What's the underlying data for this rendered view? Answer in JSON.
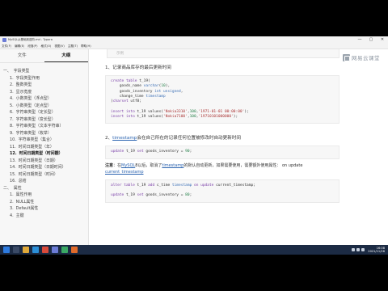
{
  "window": {
    "title": "MySQL从基础到进阶.md - Typora",
    "controls": [
      "—",
      "▢",
      "✕"
    ]
  },
  "menu": [
    "文件(F)",
    "编辑(E)",
    "段落(P)",
    "格式(O)",
    "视图(V)",
    "主题(T)",
    "帮助(H)"
  ],
  "sidebar": {
    "tabs": [
      "文件",
      "大纲"
    ],
    "outline": [
      {
        "num": "一、",
        "label": "字段类型",
        "level": 1
      },
      {
        "num": "1.",
        "label": "字段类型作用",
        "level": 2
      },
      {
        "num": "2.",
        "label": "整数类型",
        "level": 2
      },
      {
        "num": "3.",
        "label": "显示宽度",
        "level": 2
      },
      {
        "num": "4.",
        "label": "小数类型（浮点型）",
        "level": 2
      },
      {
        "num": "5.",
        "label": "小数类型（定点型）",
        "level": 2
      },
      {
        "num": "6.",
        "label": "字符串类型（定长型）",
        "level": 2
      },
      {
        "num": "7.",
        "label": "字符串类型（变长型）",
        "level": 2
      },
      {
        "num": "8.",
        "label": "字符串类型（文本字符串）",
        "level": 2
      },
      {
        "num": "9.",
        "label": "字符串类型（枚举）",
        "level": 2
      },
      {
        "num": "10.",
        "label": "字符串类型（集合）",
        "level": 2
      },
      {
        "num": "11.",
        "label": "时间日期类型（年）",
        "level": 2
      },
      {
        "num": "12.",
        "label": "时间日期类型（时间戳）",
        "level": 2,
        "active": true
      },
      {
        "num": "13.",
        "label": "时间日期类型（日期）",
        "level": 2
      },
      {
        "num": "14.",
        "label": "时间日期类型（日期时间）",
        "level": 2
      },
      {
        "num": "15.",
        "label": "时间日期类型（时间）",
        "level": 2
      },
      {
        "num": "16.",
        "label": "总结",
        "level": 2
      },
      {
        "num": "二、",
        "label": "属性",
        "level": 1
      },
      {
        "num": "1.",
        "label": "属性作用",
        "level": 2
      },
      {
        "num": "2.",
        "label": "NULL属性",
        "level": 2
      },
      {
        "num": "3.",
        "label": "Default属性",
        "level": 2
      },
      {
        "num": "4.",
        "label": "主键",
        "level": 2
      }
    ]
  },
  "editor": {
    "lang_tag": "示例",
    "logo_text": "网易云课堂",
    "heading1": "1、记录商品库存的最后更新时间",
    "code1": {
      "line1_kw": "create table",
      "line1_rest": " t_19(",
      "line2_name": "    goods_name ",
      "line2_type": "varchar",
      "line2_num": "10",
      "line2_end": "),",
      "line3_name": "    goods_inventory ",
      "line3_type": "int unsigned",
      "line3_end": ",",
      "line4_name": "    change_time ",
      "line4_type": "timestamp",
      "line5_start": ")",
      "line5_kw": "charset",
      "line5_end": " utf8;",
      "line7_kw": "insert into",
      "line7_mid": " t_19 values(",
      "line7_s1": "'Nokia3310'",
      "line7_c1": ",",
      "line7_n1": "100",
      "line7_c2": ",",
      "line7_s2": "'1971-01-01 00:00:00'",
      "line7_end": ");",
      "line8_kw": "insert into",
      "line8_mid": " t_19 values(",
      "line8_s1": "'Nokia7100'",
      "line8_c1": ",",
      "line8_n1": "100",
      "line8_c2": ",",
      "line8_s2": "'19710101000000'",
      "line8_end": ");"
    },
    "heading2_prefix": "2、",
    "heading2_link": "timestamp",
    "heading2_rest": "会在自己所在的记录任何位置被修改时自动更新时间",
    "code2": {
      "kw": "update",
      "rest": " t_19 ",
      "kw2": "set",
      "rest2": " goods_inventory = ",
      "num": "90",
      "end": ";"
    },
    "note": {
      "label": "注意",
      "text1": "：在",
      "link1": "MySQL",
      "text2": "8以后，取消了",
      "link2": "timestamp",
      "text3": "的默认自动更新，如果需要使用，需要额外使用属性： on update ",
      "link3": "current_timestamp"
    },
    "code3": {
      "kw": "alter table",
      "rest": " t_19 ",
      "kw2": "add",
      "rest2": " c_time ",
      "ty": "timestamp",
      "kw3": " on update",
      "rest3": " current_timestamp;",
      "kw4": "update",
      "rest4": " t_19 ",
      "kw5": "set",
      "rest5": " goods_inventory = ",
      "num": "80",
      "end": ";"
    }
  },
  "taskbar": {
    "time": "16:08",
    "date": "2021/11/26"
  }
}
